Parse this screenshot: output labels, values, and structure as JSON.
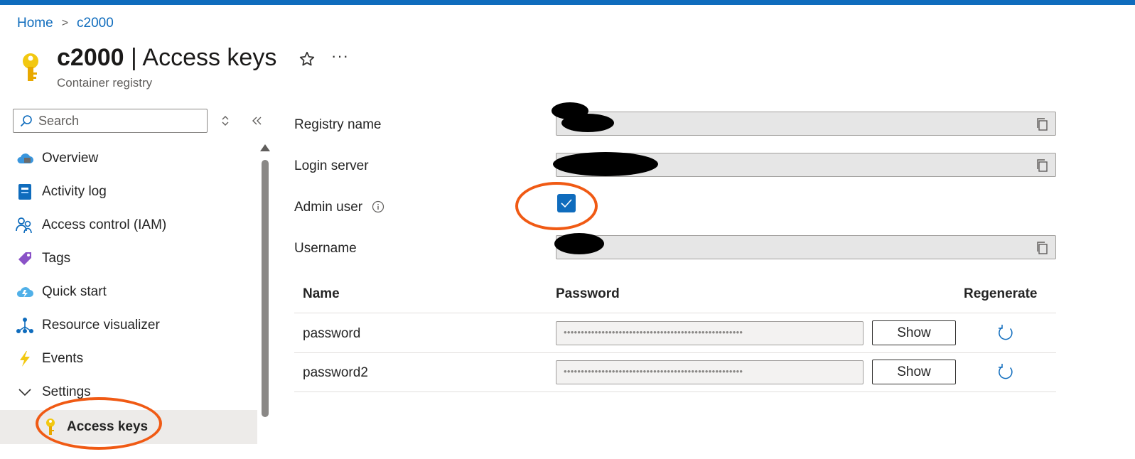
{
  "breadcrumb": {
    "home": "Home",
    "separator": ">",
    "current": "c2000"
  },
  "header": {
    "title_name": "c2000",
    "title_section": " | Access keys",
    "subtitle": "Container registry",
    "more": "···"
  },
  "sidebar": {
    "search_placeholder": "Search",
    "items": [
      {
        "label": "Overview",
        "icon": "cloud-overview-icon"
      },
      {
        "label": "Activity log",
        "icon": "activity-log-icon"
      },
      {
        "label": "Access control (IAM)",
        "icon": "people-icon"
      },
      {
        "label": "Tags",
        "icon": "tag-icon"
      },
      {
        "label": "Quick start",
        "icon": "quick-start-cloud-icon"
      },
      {
        "label": "Resource visualizer",
        "icon": "hierarchy-icon"
      },
      {
        "label": "Events",
        "icon": "lightning-icon"
      },
      {
        "label": "Settings",
        "icon": "chevron-down-icon"
      },
      {
        "label": "Access keys",
        "icon": "key-icon"
      }
    ]
  },
  "form": {
    "registry_name_label": "Registry name",
    "login_server_label": "Login server",
    "admin_user_label": "Admin user",
    "admin_user_checked": true,
    "username_label": "Username"
  },
  "table": {
    "headers": {
      "name": "Name",
      "password": "Password",
      "regenerate": "Regenerate"
    },
    "rows": [
      {
        "name": "password",
        "masked": "••••••••••••••••••••••••••••••••••••••••••••••••••••",
        "show_label": "Show"
      },
      {
        "name": "password2",
        "masked": "••••••••••••••••••••••••••••••••••••••••••••••••••••",
        "show_label": "Show"
      }
    ]
  },
  "colors": {
    "accent": "#0f6cbd",
    "annotation": "#f05a14",
    "selected_bg": "#edebe9"
  }
}
